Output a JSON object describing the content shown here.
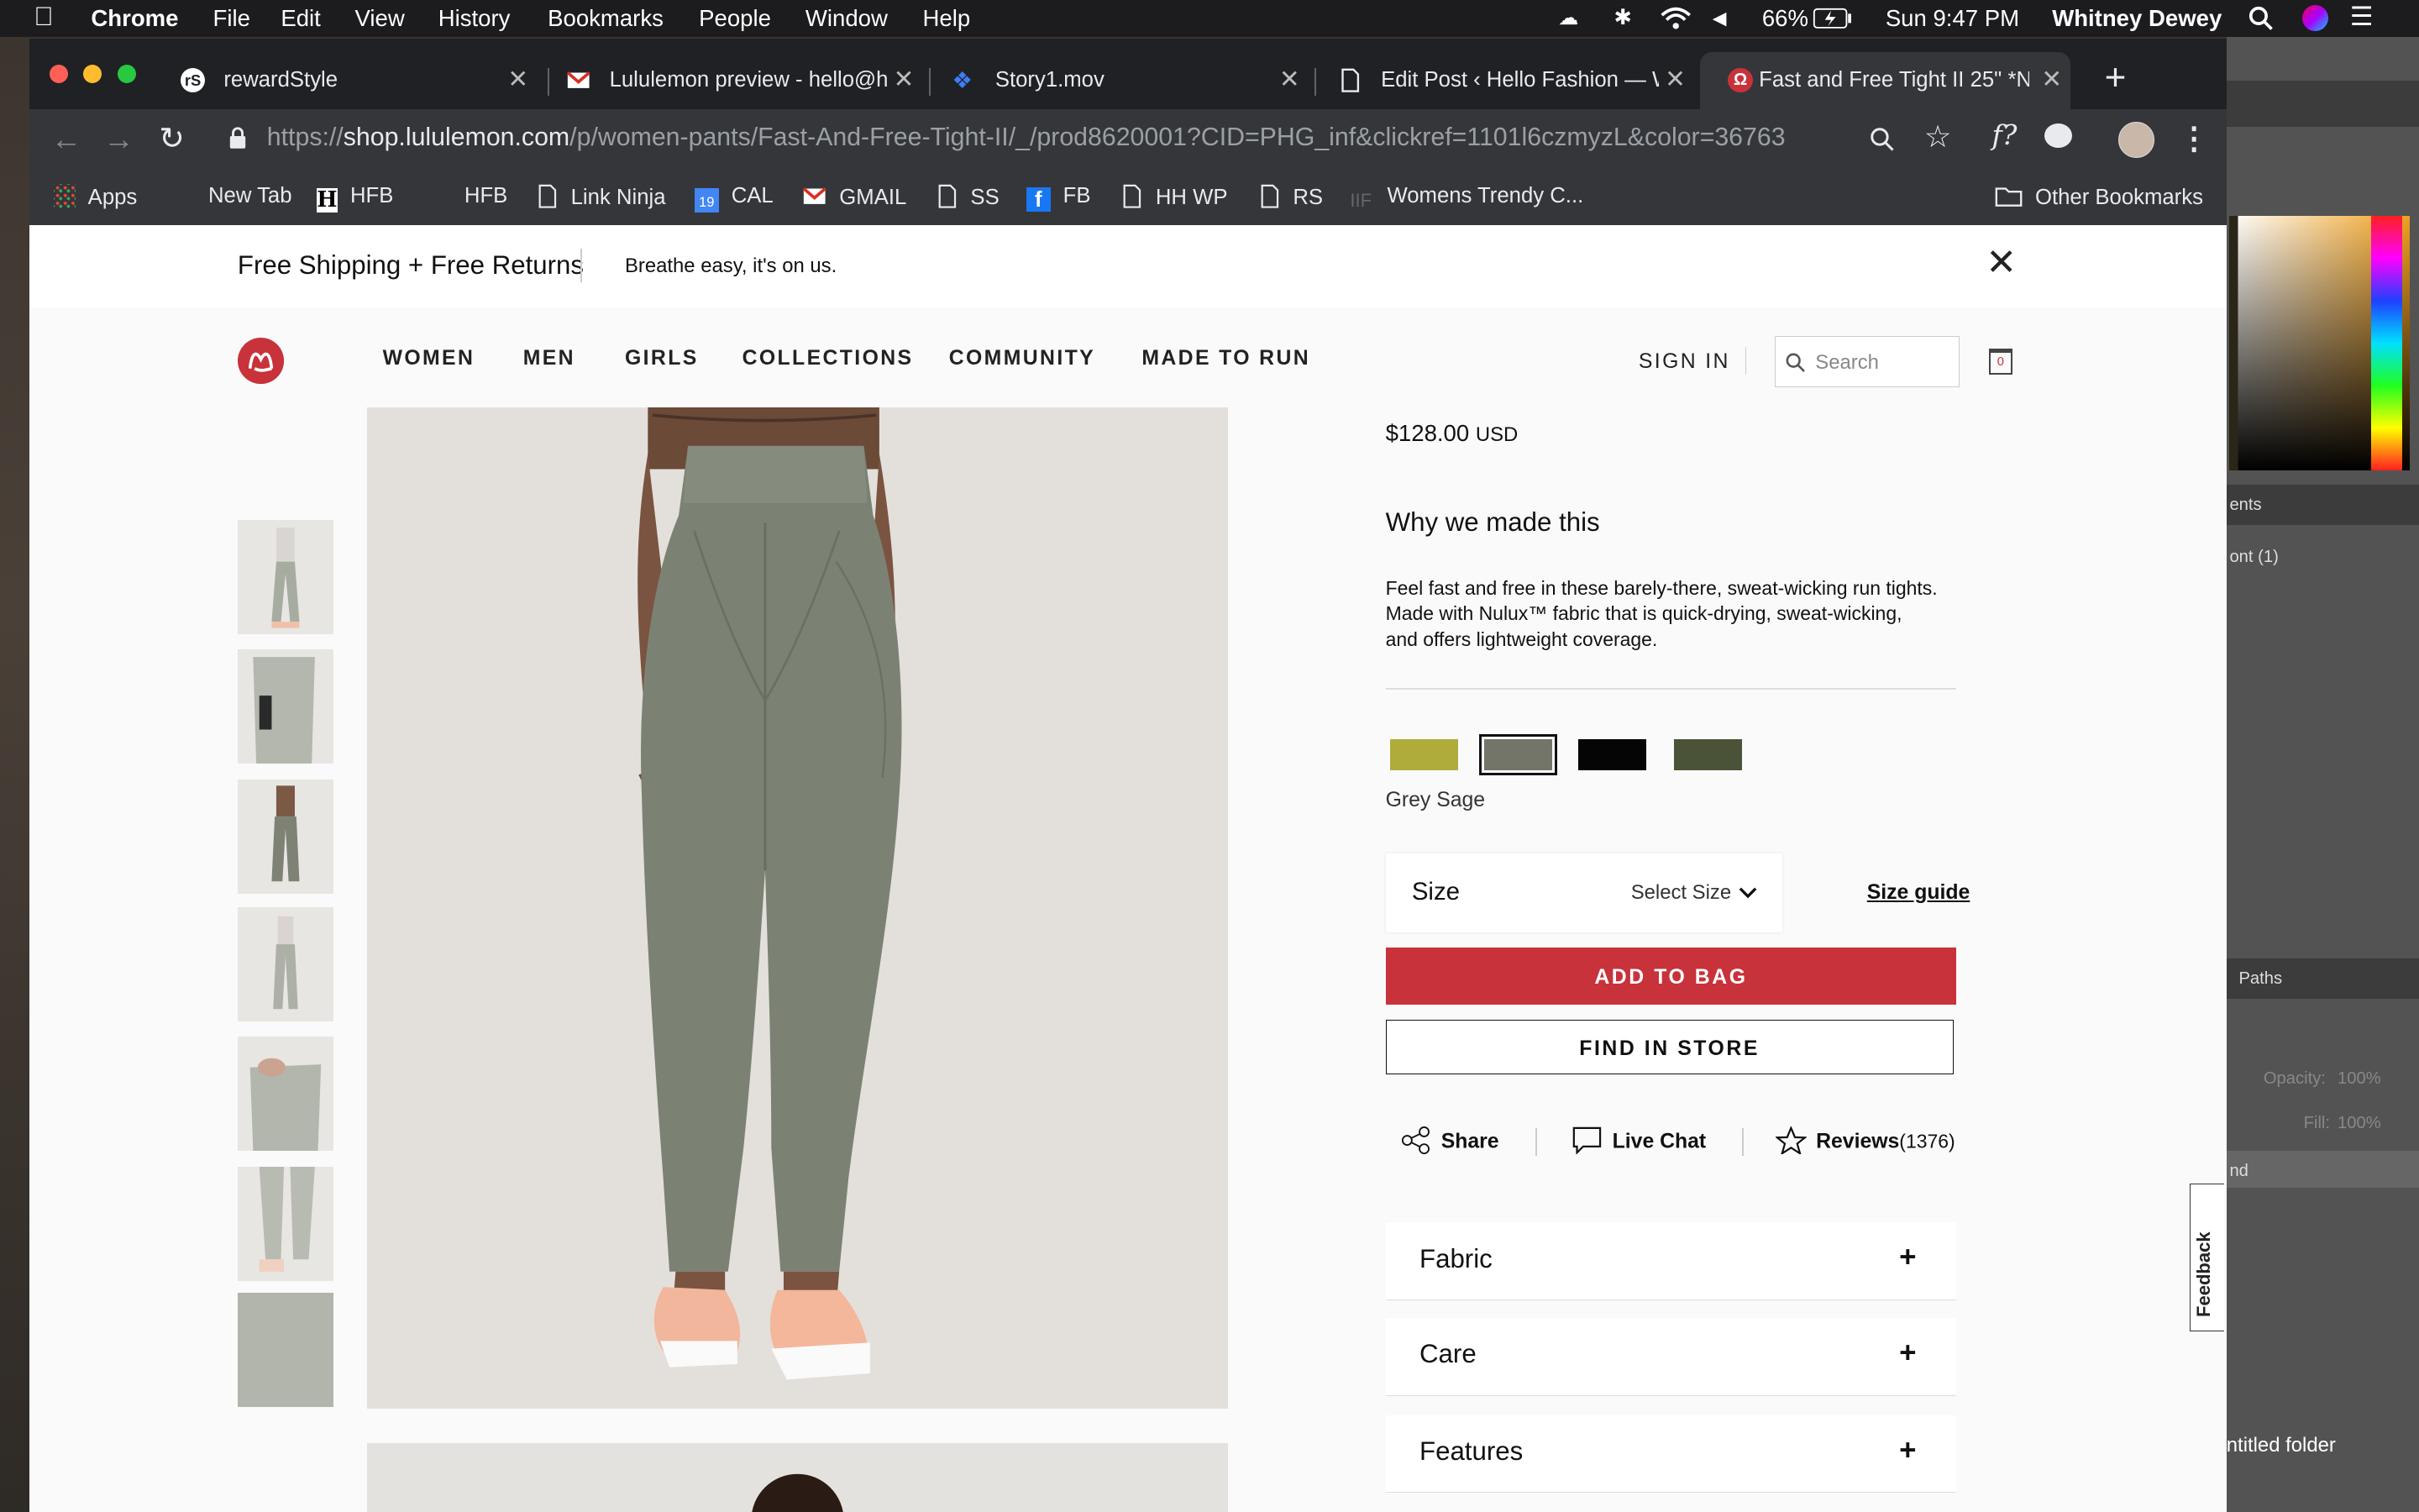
{
  "menubar": {
    "app": "Chrome",
    "items": [
      "File",
      "Edit",
      "View",
      "History",
      "Bookmarks",
      "People",
      "Window",
      "Help"
    ],
    "battery": "66%",
    "clock": "Sun 9:47 PM",
    "user": "Whitney Dewey"
  },
  "tabs": [
    {
      "title": "rewardStyle"
    },
    {
      "title": "Lululemon preview - hello@h"
    },
    {
      "title": "Story1.mov"
    },
    {
      "title": "Edit Post ‹ Hello Fashion — W"
    },
    {
      "title": "Fast and Free Tight II 25\" *N"
    }
  ],
  "url": {
    "scheme": "https://",
    "host": "shop.lululemon.com",
    "path": "/p/women-pants/Fast-And-Free-Tight-II/_/prod8620001?CID=PHG_inf&clickref=1101l6czmyzL&color=36763"
  },
  "bookmarks": {
    "apps": "Apps",
    "items": [
      "New Tab",
      "HFB",
      "HFB",
      "Link Ninja",
      "CAL",
      "GMAIL",
      "SS",
      "FB",
      "HH WP",
      "RS",
      "Womens Trendy C..."
    ],
    "cal_day": "19",
    "other": "Other Bookmarks"
  },
  "promo": {
    "title": "Free Shipping + Free Returns",
    "subtitle": "Breathe easy, it's on us."
  },
  "nav": {
    "links": [
      "WOMEN",
      "MEN",
      "GIRLS",
      "COLLECTIONS",
      "COMMUNITY",
      "MADE TO RUN"
    ],
    "sign_in": "SIGN IN",
    "search_placeholder": "Search",
    "bag_count": "0"
  },
  "product": {
    "price": "$128.00",
    "currency": "USD",
    "why_title": "Why we made this",
    "description": "Feel fast and free in these barely-there, sweat-wicking run tights. Made with Nulux™ fabric that is quick-drying, sweat-wicking, and offers lightweight coverage.",
    "selected_color": "Grey Sage",
    "swatches": [
      {
        "color": "#b0ac3c",
        "selected": false
      },
      {
        "color": "#737568",
        "selected": true
      },
      {
        "color": "#050505",
        "selected": false
      },
      {
        "color": "#4a5237",
        "selected": false
      }
    ],
    "size_label": "Size",
    "size_select": "Select Size",
    "size_guide": "Size guide",
    "add_to_bag": "ADD TO BAG",
    "find_in_store": "FIND IN STORE",
    "share": "Share",
    "live_chat": "Live Chat",
    "reviews": "Reviews",
    "reviews_count": "(1376)",
    "accordions": [
      "Fabric",
      "Care",
      "Features"
    ]
  },
  "feedback": "Feedback",
  "photoshop": {
    "panel_ents": "ents",
    "font_label": "ont (1)",
    "paths": "Paths",
    "opacity": "Opacity:",
    "opacity_val": "100%",
    "fill": "Fill:",
    "fill_val": "100%",
    "layer": "nd",
    "folder": "ntitled folder"
  },
  "colors": {
    "accent_red": "#c8323a",
    "chrome_dark": "#202124",
    "chrome_toolbar": "#35363a"
  }
}
